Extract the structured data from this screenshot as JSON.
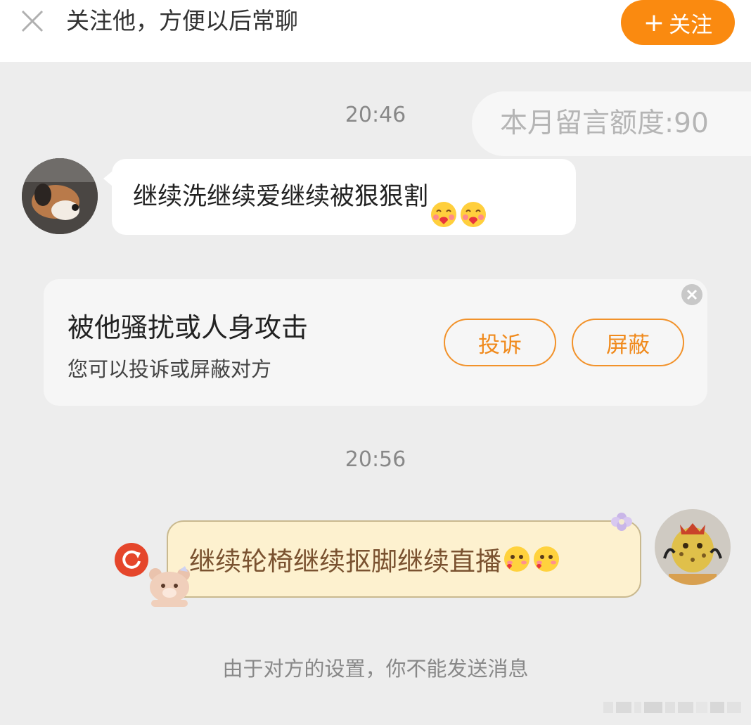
{
  "topbar": {
    "prompt": "关注他，方便以后常聊",
    "follow_plus": "+",
    "follow_label": "关注"
  },
  "chat": {
    "time1": "20:46",
    "quota": "本月留言额度:90",
    "incoming_message": "继续洗继续爱继续被狠狠割",
    "incoming_emojis": [
      "hug-heart-emoji",
      "hug-heart-emoji"
    ],
    "time2": "20:56",
    "outgoing_message": "继续轮椅继续抠脚继续直播",
    "outgoing_emojis": [
      "blush-heart-emoji",
      "blush-heart-emoji"
    ],
    "notice": "由于对方的设置，你不能发送消息"
  },
  "safety_card": {
    "title": "被他骚扰或人身攻击",
    "subtitle": "您可以投诉或屏蔽对方",
    "report_label": "投诉",
    "block_label": "屏蔽"
  },
  "colors": {
    "accent": "#fa8a10",
    "outgoing_bubble": "#fdf1cf",
    "retry_red": "#e5462b"
  }
}
